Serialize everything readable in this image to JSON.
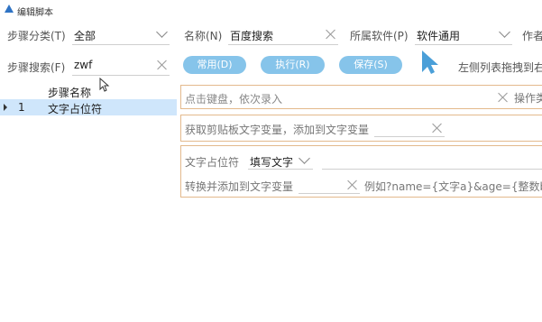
{
  "window": {
    "title": "编辑脚本"
  },
  "filters": {
    "category_label": "步骤分类(T)",
    "category_value": "全部",
    "name_label": "名称(N)",
    "name_value": "百度搜索",
    "software_label": "所属软件(P)",
    "software_value": "软件通用",
    "author_label": "作者",
    "search_label": "步骤搜索(F)",
    "search_value": "zwf"
  },
  "buttons": {
    "common": "常用(D)",
    "run": "执行(R)",
    "save": "保存(S)"
  },
  "hint": "左侧列表拖拽到右",
  "step_list": {
    "header": "步骤名称",
    "rows": [
      {
        "num": "1",
        "name": "文字占位符"
      }
    ]
  },
  "editor": {
    "keyboard_placeholder": "点击键盘，依次录入",
    "operation_label": "操作类",
    "clipboard_text": "获取剪贴板文字变量，添加到文字变量",
    "placeholder_label": "文字占位符",
    "placeholder_mode": "填写文字",
    "convert_label": "转换并添加到文字变量",
    "example_text": "例如?name={文字a}&age={整数b}"
  },
  "colors": {
    "button_bg": "#86c4ea",
    "selection_bg": "#cfe6fb",
    "box_border": "#e3b98c",
    "cursor_blue": "#4a9fd8"
  }
}
